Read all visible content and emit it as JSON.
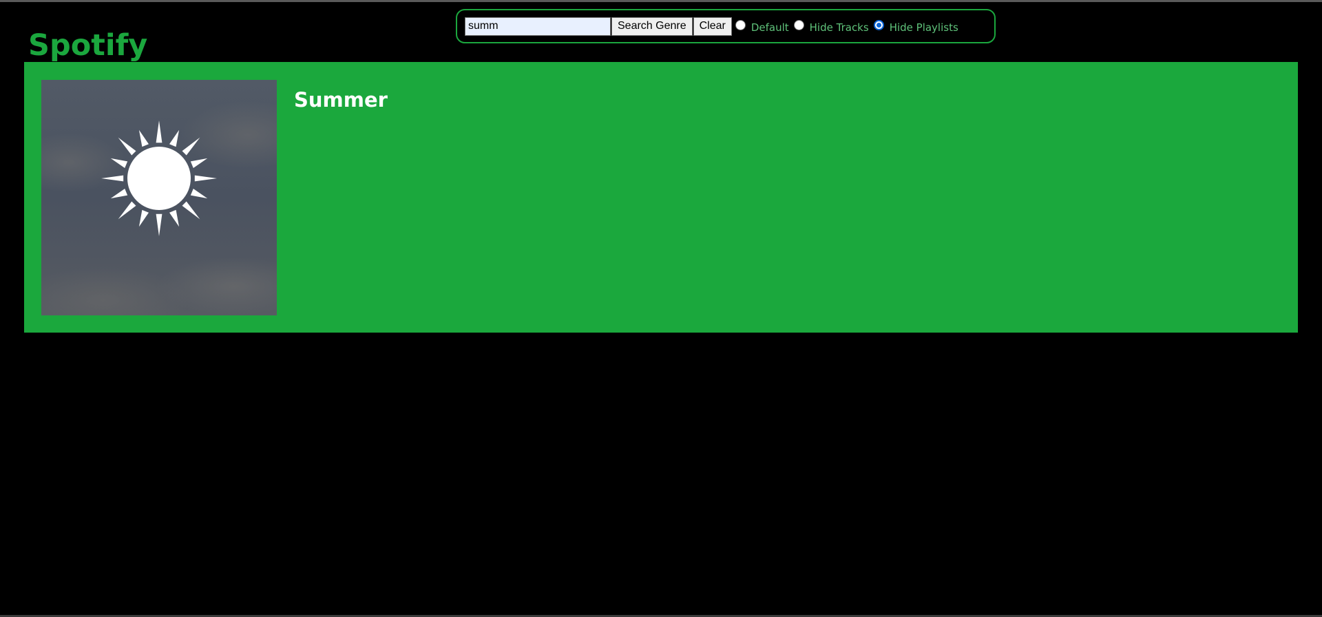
{
  "app": {
    "title": "Spotify"
  },
  "search": {
    "value": "summ",
    "search_button_label": "Search Genre",
    "clear_button_label": "Clear"
  },
  "filter": {
    "options": [
      {
        "label": "Default",
        "checked": false
      },
      {
        "label": "Hide Tracks",
        "checked": false
      },
      {
        "label": "Hide Playlists",
        "checked": true
      }
    ],
    "selected": "Hide Playlists"
  },
  "results": [
    {
      "name": "Summer",
      "cover_icon": "sun-icon"
    }
  ],
  "colors": {
    "brand_green": "#1ba73e",
    "card_green": "#1ba83d",
    "background": "#000000",
    "radio_selected": "#0a64d8"
  }
}
